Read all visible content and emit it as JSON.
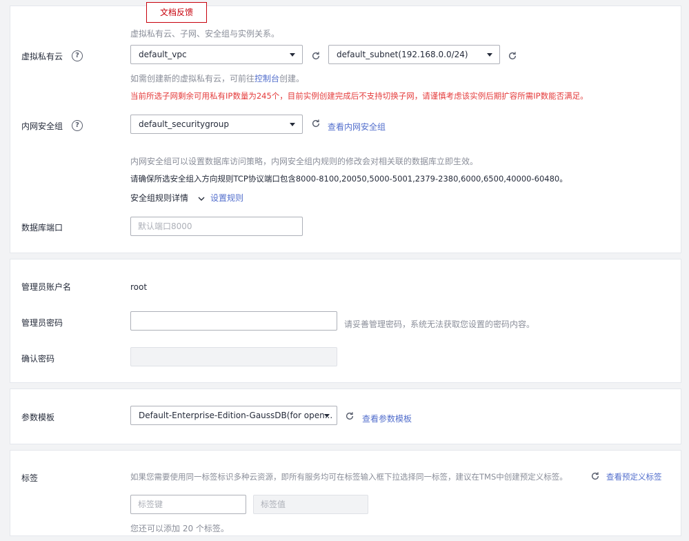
{
  "feedback": {
    "label": "文档反馈"
  },
  "network": {
    "intro": "虚拟私有云、子网、安全组与实例关系。",
    "vpc": {
      "label": "虚拟私有云",
      "vpc_value": "default_vpc",
      "subnet_value": "default_subnet(192.168.0.0/24)",
      "hint_prefix": "如需创建新的虚拟私有云，可前往",
      "hint_link": "控制台",
      "hint_suffix": "创建。",
      "warning": "当前所选子网剩余可用私有IP数量为245个，目前实例创建完成后不支持切换子网，请谨慎考虑该实例后期扩容所需IP数能否满足。"
    },
    "security": {
      "label": "内网安全组",
      "value": "default_securitygroup",
      "view_link": "查看内网安全组",
      "desc": "内网安全组可以设置数据库访问策略，内网安全组内规则的修改会对相关联的数据库立即生效。",
      "ports_note": "请确保所选安全组入方向规则TCP协议端口包含8000-8100,20050,5000-5001,2379-2380,6000,6500,40000-60480。",
      "rules_detail": "安全组规则详情",
      "set_rules": "设置规则"
    },
    "port": {
      "label": "数据库端口",
      "placeholder": "默认端口8000"
    }
  },
  "admin": {
    "account_label": "管理员账户名",
    "account_value": "root",
    "password_label": "管理员密码",
    "password_hint": "请妥善管理密码，系统无法获取您设置的密码内容。",
    "confirm_label": "确认密码"
  },
  "params": {
    "label": "参数模板",
    "value": "Default-Enterprise-Edition-GaussDB(for open...",
    "view_link": "查看参数模板"
  },
  "tags": {
    "label": "标签",
    "desc": "如果您需要使用同一标签标识多种云资源，即所有服务均可在标签输入框下拉选择同一标签，建议在TMS中创建预定义标签。",
    "view_link": "查看预定义标签",
    "key_placeholder": "标签键",
    "value_placeholder": "标签值",
    "remaining": "您还可以添加 20 个标签。"
  },
  "icons": [
    "help-icon",
    "refresh-icon",
    "chevron-down-icon",
    "caret-down-icon"
  ]
}
